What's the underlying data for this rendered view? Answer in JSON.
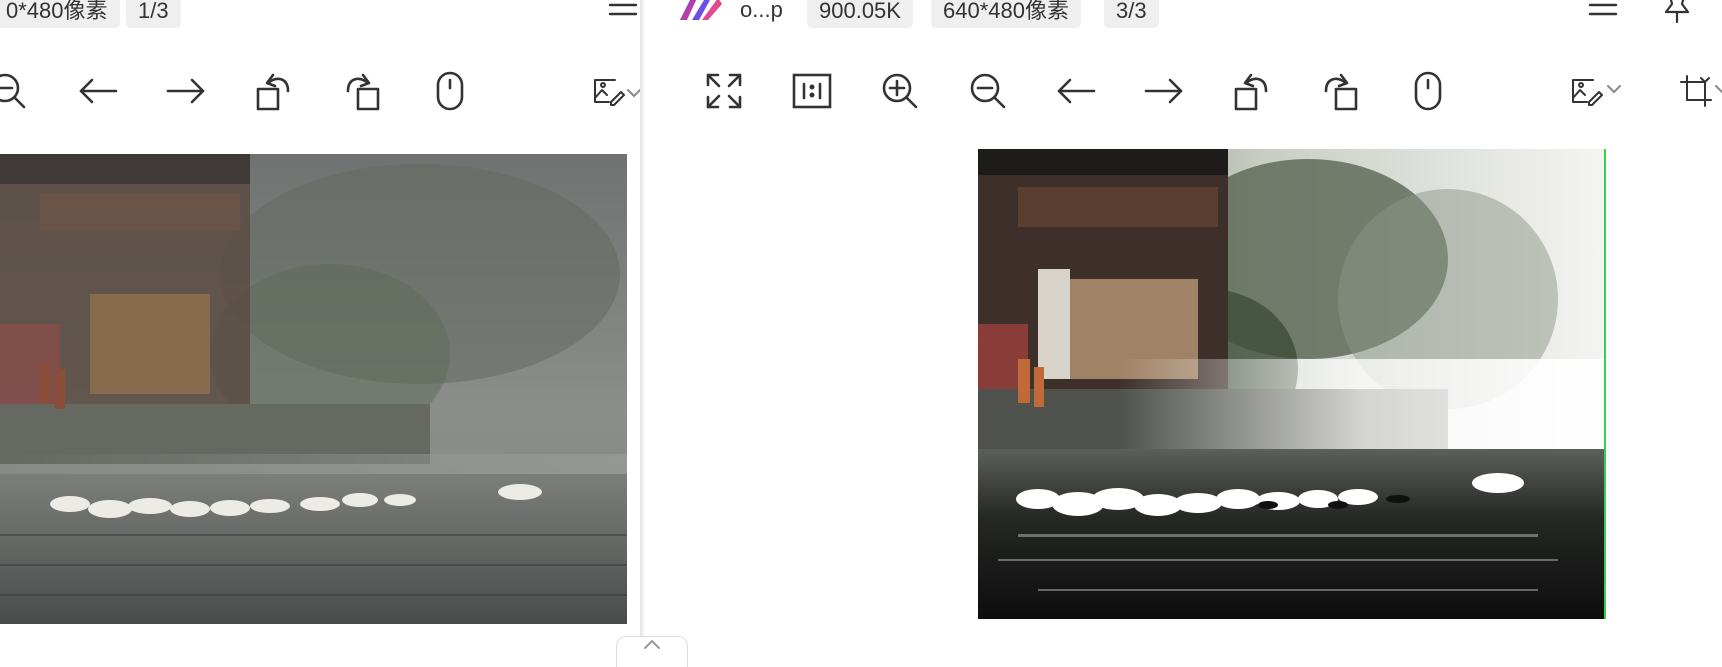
{
  "left_viewer": {
    "chips": {
      "dimensions": "0*480像素",
      "page": "1/3"
    },
    "toolbar": [
      "zoom-out",
      "previous",
      "next",
      "rotate-left",
      "rotate-right",
      "mouse-mode",
      "image-edit"
    ],
    "image_alt": "Geese swimming on a misty river in front of old riverside houses"
  },
  "right_viewer": {
    "filename": "o...p",
    "chips": {
      "filesize": "900.05K",
      "dimensions": "640*480像素",
      "page": "3/3"
    },
    "toolbar": [
      "fullscreen",
      "actual-size",
      "zoom-in",
      "zoom-out",
      "previous",
      "next",
      "rotate-left",
      "rotate-right",
      "mouse-mode",
      "image-edit",
      "crop"
    ],
    "image_alt": "Enhanced contrast version of geese on river with houses"
  },
  "colors": {
    "chip_bg": "#efefef",
    "icon": "#333333",
    "logo_a": "#7b3fe4",
    "logo_b": "#e0407a",
    "selection": "#35d04a"
  }
}
